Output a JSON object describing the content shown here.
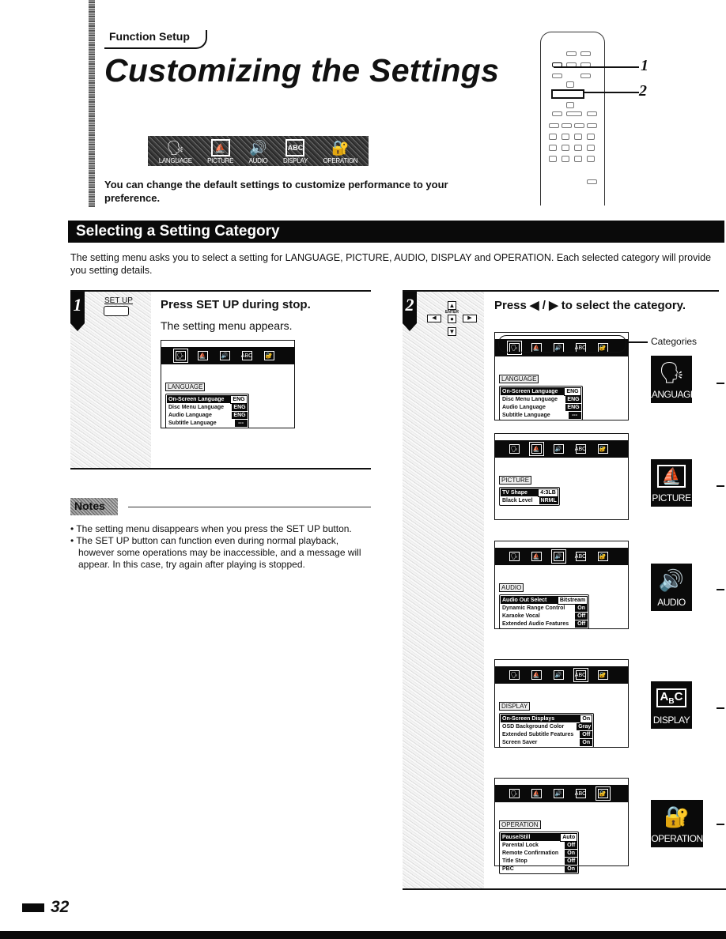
{
  "header": {
    "section_tag": "Function Setup",
    "title": "Customizing the Settings",
    "intro": "You can change the default settings to customize performance to your preference.",
    "category_strip": [
      {
        "label": "LANGUAGE",
        "icon": "speaking-head-icon"
      },
      {
        "label": "PICTURE",
        "icon": "sailboat-picture-icon"
      },
      {
        "label": "AUDIO",
        "icon": "speaker-icon"
      },
      {
        "label": "DISPLAY",
        "icon": "abc-monitor-icon"
      },
      {
        "label": "OPERATION",
        "icon": "lock-key-icon"
      }
    ]
  },
  "remote": {
    "callouts": [
      "1",
      "2"
    ]
  },
  "section": {
    "title": "Selecting a Setting Category",
    "description": "The setting menu asks you to select a setting for LANGUAGE, PICTURE, AUDIO, DISPLAY and OPERATION.  Each selected category will provide you setting details."
  },
  "step1": {
    "number": "1",
    "button_label": "SET UP",
    "heading": "Press SET UP during stop.",
    "subtext": "The setting menu appears."
  },
  "step2": {
    "number": "2",
    "button_label": "ENTER",
    "heading": "Press ◀ / ▶ to select the category.",
    "categories_label": "Categories"
  },
  "menus": {
    "language": {
      "label": "LANGUAGE",
      "rows": [
        {
          "name": "On-Screen Language",
          "value": "ENG"
        },
        {
          "name": "Disc Menu Language",
          "value": "ENG"
        },
        {
          "name": "Audio Language",
          "value": "ENG"
        },
        {
          "name": "Subtitle Language",
          "value": "---"
        }
      ]
    },
    "picture": {
      "label": "PICTURE",
      "rows": [
        {
          "name": "TV Shape",
          "value": "4:3LB"
        },
        {
          "name": "Black Level",
          "value": "NRML"
        }
      ]
    },
    "audio": {
      "label": "AUDIO",
      "rows": [
        {
          "name": "Audio Out Select",
          "value": "Bitstream"
        },
        {
          "name": "Dynamic Range Control",
          "value": "On"
        },
        {
          "name": "Karaoke Vocal",
          "value": "Off"
        },
        {
          "name": "Extended Audio Features",
          "value": "Off"
        }
      ]
    },
    "display": {
      "label": "DISPLAY",
      "rows": [
        {
          "name": "On-Screen Displays",
          "value": "On"
        },
        {
          "name": "OSD Background Color",
          "value": "Gray"
        },
        {
          "name": "Extended Subtitle Features",
          "value": "Off"
        },
        {
          "name": "Screen Saver",
          "value": "On"
        }
      ]
    },
    "operation": {
      "label": "OPERATION",
      "rows": [
        {
          "name": "Pause/Still",
          "value": "Auto"
        },
        {
          "name": "Parental Lock",
          "value": "Off"
        },
        {
          "name": "Remote Confirmation",
          "value": "On"
        },
        {
          "name": "Title Stop",
          "value": "Off"
        },
        {
          "name": "PBC",
          "value": "On"
        }
      ]
    }
  },
  "category_boxes": [
    {
      "label": "LANGUAGE",
      "icon": "speaking-head-icon"
    },
    {
      "label": "PICTURE",
      "icon": "sailboat-picture-icon"
    },
    {
      "label": "AUDIO",
      "icon": "speaker-icon"
    },
    {
      "label": "DISPLAY",
      "icon": "abc-monitor-icon"
    },
    {
      "label": "OPERATION",
      "icon": "lock-key-icon"
    }
  ],
  "notes": {
    "title": "Notes",
    "items": [
      "The setting menu disappears when you press the SET UP button.",
      "The SET UP button can function even during normal playback, however some operations may be inaccessible, and a message will appear. In this case, try again after playing is stopped."
    ]
  },
  "footer": {
    "page_number": "32"
  }
}
